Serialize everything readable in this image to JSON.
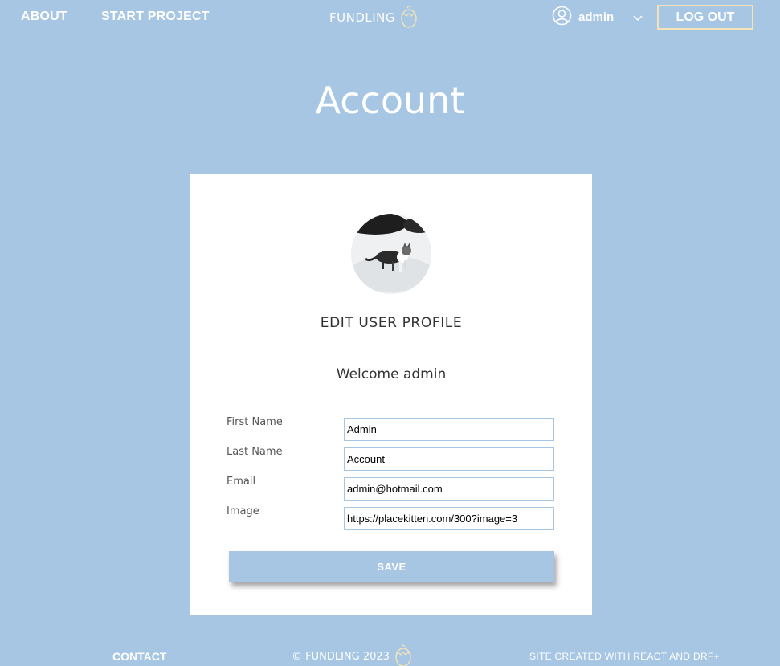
{
  "nav": {
    "about_label": "ABOUT",
    "start_project_label": "START PROJECT",
    "brand": "FUNDLING",
    "user_name": "admin",
    "logout_label": "LOG OUT"
  },
  "page": {
    "title": "Account"
  },
  "profile": {
    "heading": "EDIT USER PROFILE",
    "welcome": "Welcome admin",
    "fields": [
      {
        "label": "First Name",
        "value": "Admin"
      },
      {
        "label": "Last Name",
        "value": "Account"
      },
      {
        "label": "Email",
        "value": "admin@hotmail.com"
      },
      {
        "label": "Image",
        "value": "https://placekitten.com/300?image=3"
      }
    ],
    "save_label": "SAVE"
  },
  "footer": {
    "contact_label": "CONTACT",
    "copyright": "© FUNDLING 2023",
    "credit": "SITE CREATED WITH REACT AND DRF+"
  },
  "colors": {
    "background": "#a6c6e4",
    "card": "#ffffff",
    "logout_border": "#f3e3b6",
    "egg_icon": "#f3e3b6"
  },
  "icons": [
    "egg-icon",
    "user-circle-icon",
    "chevron-down-icon"
  ]
}
